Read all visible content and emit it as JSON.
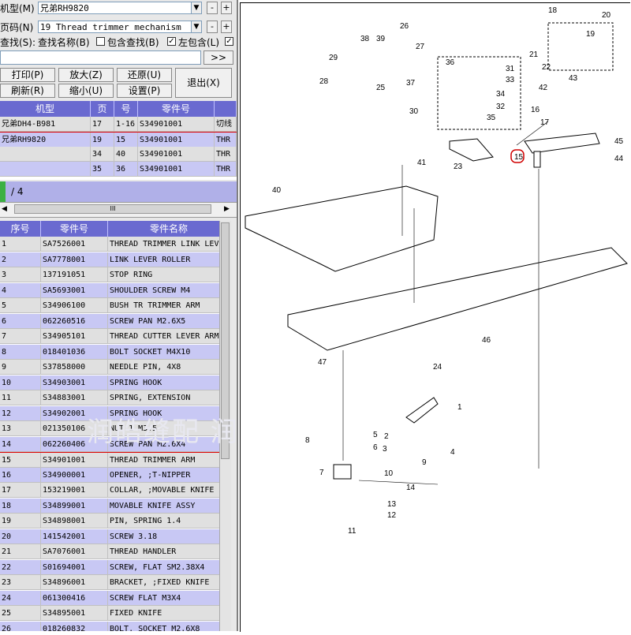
{
  "search": {
    "model_label": "机型(M)",
    "model_value": "兄弟RH9820",
    "page_label": "页码(N)",
    "page_value": "19 Thread trimmer mechanism",
    "find_label": "查找(S):",
    "find_by_name_label": "查找名称(B)",
    "include_find_label": "包含查找(B)",
    "left_include_label": "左包含(L)",
    "find_input_value": "",
    "go_button": ">>",
    "minus": "-",
    "plus": "+"
  },
  "toolbar": {
    "print": "打印(P)",
    "zoom_in": "放大(Z)",
    "restore": "还原(U)",
    "exit": "退出(X)",
    "refresh": "刷新(R)",
    "zoom_out": "缩小(U)",
    "settings": "设置(P)"
  },
  "top_table": {
    "headers": [
      "机型",
      "页",
      "号",
      "零件号"
    ],
    "rows": [
      {
        "model": "兄弟DH4-B981",
        "page": "17",
        "num": "1-16",
        "part": "S34901001",
        "extra": "切线"
      },
      {
        "model": "兄弟RH9820",
        "page": "19",
        "num": "15",
        "part": "S34901001",
        "extra": "THR"
      },
      {
        "model": "",
        "page": "34",
        "num": "40",
        "part": "S34901001",
        "extra": "THR"
      },
      {
        "model": "",
        "page": "35",
        "num": "36",
        "part": "S34901001",
        "extra": "THR"
      }
    ]
  },
  "pager": {
    "text": "/ 4",
    "scroll_mark": "III"
  },
  "parts_table": {
    "headers": [
      "序号",
      "零件号",
      "零件名称"
    ],
    "rows": [
      {
        "seq": "1",
        "part": "SA7526001",
        "name": "THREAD TRIMMER LINK LEV"
      },
      {
        "seq": "2",
        "part": "SA7778001",
        "name": "LINK LEVER ROLLER"
      },
      {
        "seq": "3",
        "part": "137191051",
        "name": "STOP RING"
      },
      {
        "seq": "4",
        "part": "SA5693001",
        "name": "SHOULDER SCREW M4"
      },
      {
        "seq": "5",
        "part": "S34906100",
        "name": "BUSH TR TRIMMER ARM"
      },
      {
        "seq": "6",
        "part": "062260516",
        "name": "SCREW PAN M2.6X5"
      },
      {
        "seq": "7",
        "part": "S34905101",
        "name": "THREAD CUTTER LEVER ARM"
      },
      {
        "seq": "8",
        "part": "018401036",
        "name": "BOLT SOCKET M4X10"
      },
      {
        "seq": "9",
        "part": "S37858000",
        "name": "NEEDLE PIN, 4X8"
      },
      {
        "seq": "10",
        "part": "S34903001",
        "name": "SPRING HOOK"
      },
      {
        "seq": "11",
        "part": "S34883001",
        "name": "SPRING, EXTENSION"
      },
      {
        "seq": "12",
        "part": "S34902001",
        "name": "SPRING HOOK"
      },
      {
        "seq": "13",
        "part": "021350106",
        "name": "NUT 1 M3.5"
      },
      {
        "seq": "14",
        "part": "062260406",
        "name": "SCREW PAN M2.6X4"
      },
      {
        "seq": "15",
        "part": "S34901001",
        "name": "THREAD TRIMMER ARM"
      },
      {
        "seq": "16",
        "part": "S34900001",
        "name": "OPENER, ;T-NIPPER"
      },
      {
        "seq": "17",
        "part": "153219001",
        "name": "COLLAR, ;MOVABLE KNIFE"
      },
      {
        "seq": "18",
        "part": "S34899001",
        "name": "MOVABLE KNIFE ASSY"
      },
      {
        "seq": "19",
        "part": "S34898001",
        "name": "PIN, SPRING 1.4"
      },
      {
        "seq": "20",
        "part": "141542001",
        "name": "SCREW 3.18"
      },
      {
        "seq": "21",
        "part": "SA7076001",
        "name": "THREAD HANDLER"
      },
      {
        "seq": "22",
        "part": "S01694001",
        "name": "SCREW, FLAT SM2.38X4"
      },
      {
        "seq": "23",
        "part": "S34896001",
        "name": "BRACKET, ;FIXED KNIFE"
      },
      {
        "seq": "24",
        "part": "061300416",
        "name": "SCREW FLAT M3X4"
      },
      {
        "seq": "25",
        "part": "S34895001",
        "name": "FIXED KNIFE"
      },
      {
        "seq": "26",
        "part": "018260832",
        "name": "BOLT, SOCKET M2.6X8"
      }
    ]
  },
  "watermark": "润皓缝配    润皓缝配    润皓缝配",
  "diagram": {
    "callouts": [
      "1",
      "2",
      "3",
      "4",
      "5",
      "6",
      "7",
      "8",
      "9",
      "10",
      "11",
      "12",
      "13",
      "14",
      "15",
      "16",
      "17",
      "18",
      "19",
      "20",
      "21",
      "22",
      "23",
      "24",
      "25",
      "26",
      "27",
      "28",
      "29",
      "30",
      "31",
      "32",
      "33",
      "34",
      "35",
      "36",
      "37",
      "38",
      "39",
      "40",
      "41",
      "42",
      "43",
      "44",
      "45",
      "46",
      "47"
    ],
    "highlight_color": "#d00000"
  }
}
